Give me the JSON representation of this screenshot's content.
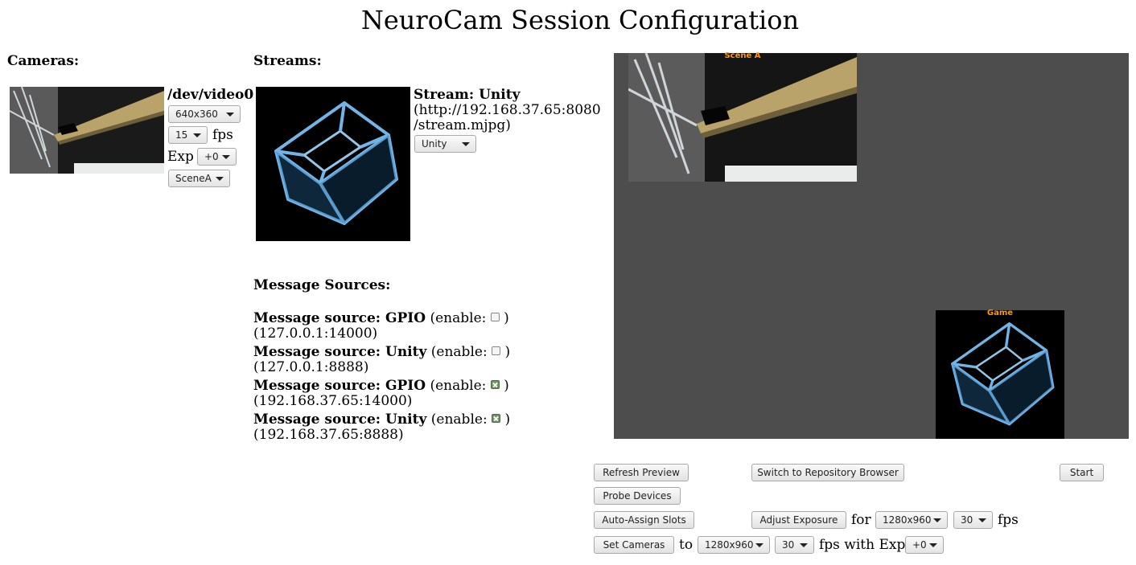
{
  "title": "NeuroCam Session Configuration",
  "cameras": {
    "heading": "Cameras:",
    "device": "/dev/video0",
    "resolution": "640x360",
    "fps_value": "15",
    "fps_label": "fps",
    "exp_label": "Exp",
    "exp_value": "+0",
    "scene": "SceneA"
  },
  "streams": {
    "heading": "Streams:",
    "name_label": "Stream: Unity",
    "url_line1": "(http://192.168.37.65:8080",
    "url_line2": "/stream.mjpg)",
    "scene": "Unity"
  },
  "message_sources": {
    "heading": "Message Sources:",
    "enable_open": "(enable:",
    "enable_close": ")",
    "items": [
      {
        "label": "Message source: GPIO",
        "address": "(127.0.0.1:14000)",
        "enabled": false
      },
      {
        "label": "Message source: Unity",
        "address": "(127.0.0.1:8888)",
        "enabled": false
      },
      {
        "label": "Message source: GPIO",
        "address": "(192.168.37.65:14000)",
        "enabled": true
      },
      {
        "label": "Message source: Unity",
        "address": "(192.168.37.65:8888)",
        "enabled": true
      }
    ]
  },
  "preview": {
    "slot_a_label": "Scene A",
    "slot_game_label": "Game",
    "background": "#4d4d4d",
    "label_color": "#ff9a00"
  },
  "controls": {
    "refresh": "Refresh Preview",
    "switch_repo": "Switch to Repository Browser",
    "start": "Start",
    "probe": "Probe Devices",
    "auto_assign": "Auto-Assign Slots",
    "adjust_exposure": "Adjust Exposure",
    "for_label": "for",
    "adjust_res": "1280x960",
    "adjust_fps": "30",
    "fps_label": "fps",
    "set_cameras": "Set Cameras",
    "to_label": "to",
    "set_res": "1280x960",
    "set_fps": "30",
    "fps_with_exp_label": "fps with Exp",
    "set_exp": "+0"
  }
}
